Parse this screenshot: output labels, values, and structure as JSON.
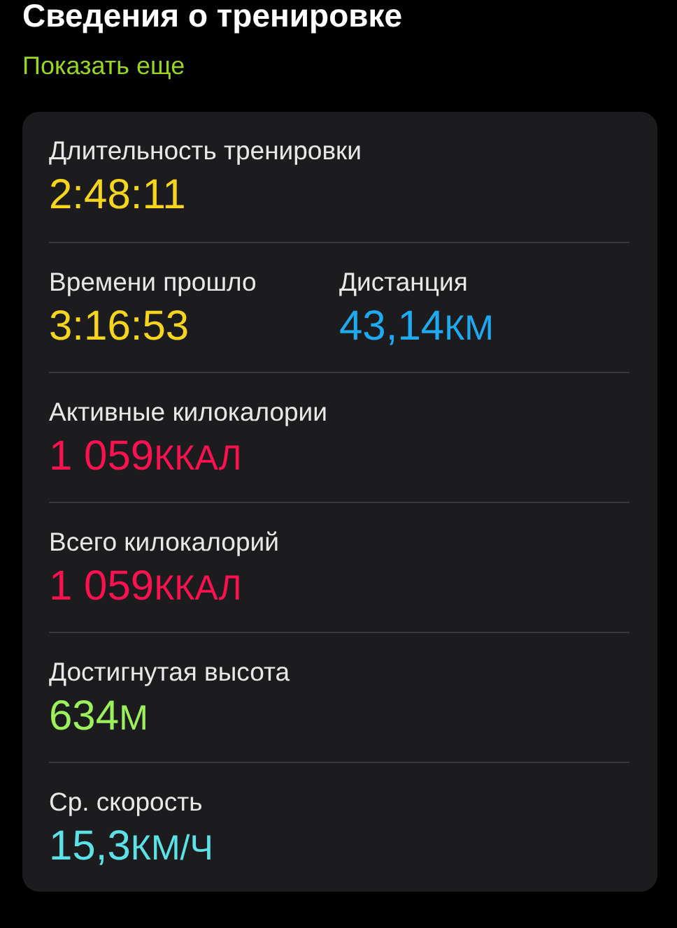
{
  "title": "Сведения о тренировке",
  "show_more": "Показать еще",
  "rows": [
    {
      "metrics": [
        {
          "label": "Длительность тренировки",
          "value": "2:48:11",
          "color": "#f7d51d"
        }
      ]
    },
    {
      "metrics": [
        {
          "label": "Времени прошло",
          "value": "3:16:53",
          "color": "#f7d51d"
        },
        {
          "label": "Дистанция",
          "value": "43,14",
          "unit": "КМ",
          "color": "#1eaaf1"
        }
      ]
    },
    {
      "metrics": [
        {
          "label": "Активные килокалории",
          "value": "1 059",
          "unit": "ККАЛ",
          "color": "#fa114f"
        }
      ]
    },
    {
      "metrics": [
        {
          "label": "Всего килокалорий",
          "value": "1 059",
          "unit": "ККАЛ",
          "color": "#fa114f"
        }
      ]
    },
    {
      "metrics": [
        {
          "label": "Достигнутая высота",
          "value": "634",
          "unit": "М",
          "color": "#9cf05b"
        }
      ]
    },
    {
      "metrics": [
        {
          "label": "Ср. скорость",
          "value": "15,3",
          "unit": "КМ/Ч",
          "color": "#5ce2e6"
        }
      ]
    }
  ]
}
